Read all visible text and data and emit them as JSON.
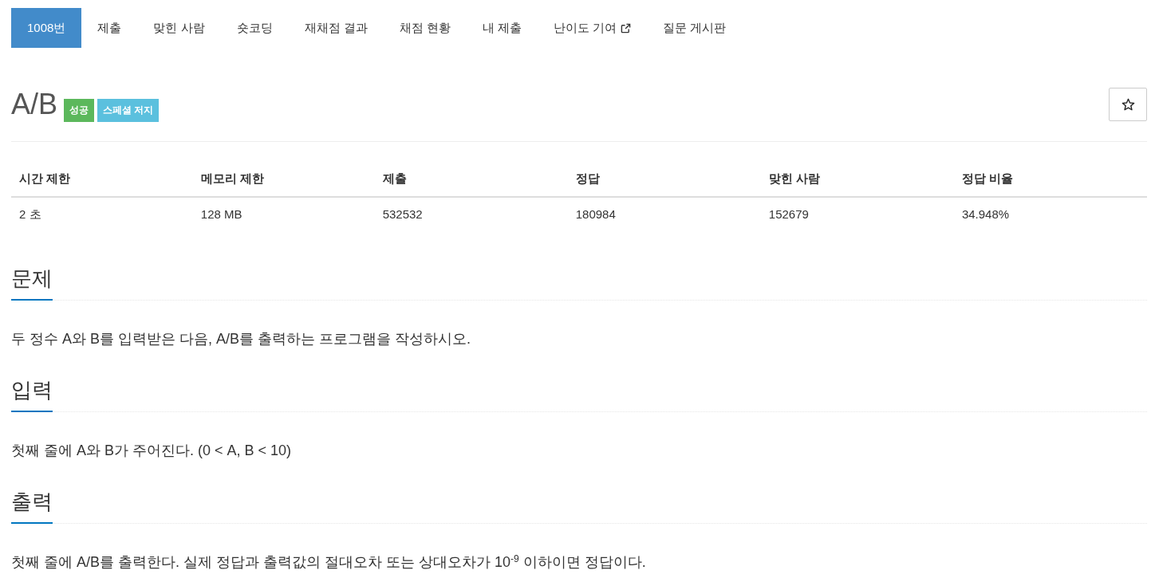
{
  "nav": {
    "tabs": [
      {
        "label": "1008번",
        "selected": true,
        "external": false
      },
      {
        "label": "제출",
        "selected": false,
        "external": false
      },
      {
        "label": "맞힌 사람",
        "selected": false,
        "external": false
      },
      {
        "label": "숏코딩",
        "selected": false,
        "external": false
      },
      {
        "label": "재채점 결과",
        "selected": false,
        "external": false
      },
      {
        "label": "채점 현황",
        "selected": false,
        "external": false
      },
      {
        "label": "내 제출",
        "selected": false,
        "external": false
      },
      {
        "label": "난이도 기여",
        "selected": false,
        "external": true
      },
      {
        "label": "질문 게시판",
        "selected": false,
        "external": false
      }
    ]
  },
  "problem": {
    "title": "A/B",
    "labels": [
      {
        "text": "성공",
        "color": "#5cb85c"
      },
      {
        "text": "스페셜 저지",
        "color": "#5bc0de"
      }
    ],
    "starred": false
  },
  "info_table": {
    "columns": [
      "시간 제한",
      "메모리 제한",
      "제출",
      "정답",
      "맞힌 사람",
      "정답 비율"
    ],
    "rows": [
      [
        "2 초",
        "128 MB",
        "532532",
        "180984",
        "152679",
        "34.948%"
      ]
    ]
  },
  "sections": [
    {
      "heading": "문제",
      "body": "두 정수 A와 B를 입력받은 다음, A/B를 출력하는 프로그램을 작성하시오."
    },
    {
      "heading": "입력",
      "body": "첫째 줄에 A와 B가 주어진다. (0 < A, B < 10)"
    },
    {
      "heading": "출력",
      "body": "첫째 줄에 A/B를 출력한다. 실제 정답과 출력값의 절대오차 또는 상대오차가 10$^{-9}$ 이하이면 정답이다."
    }
  ]
}
